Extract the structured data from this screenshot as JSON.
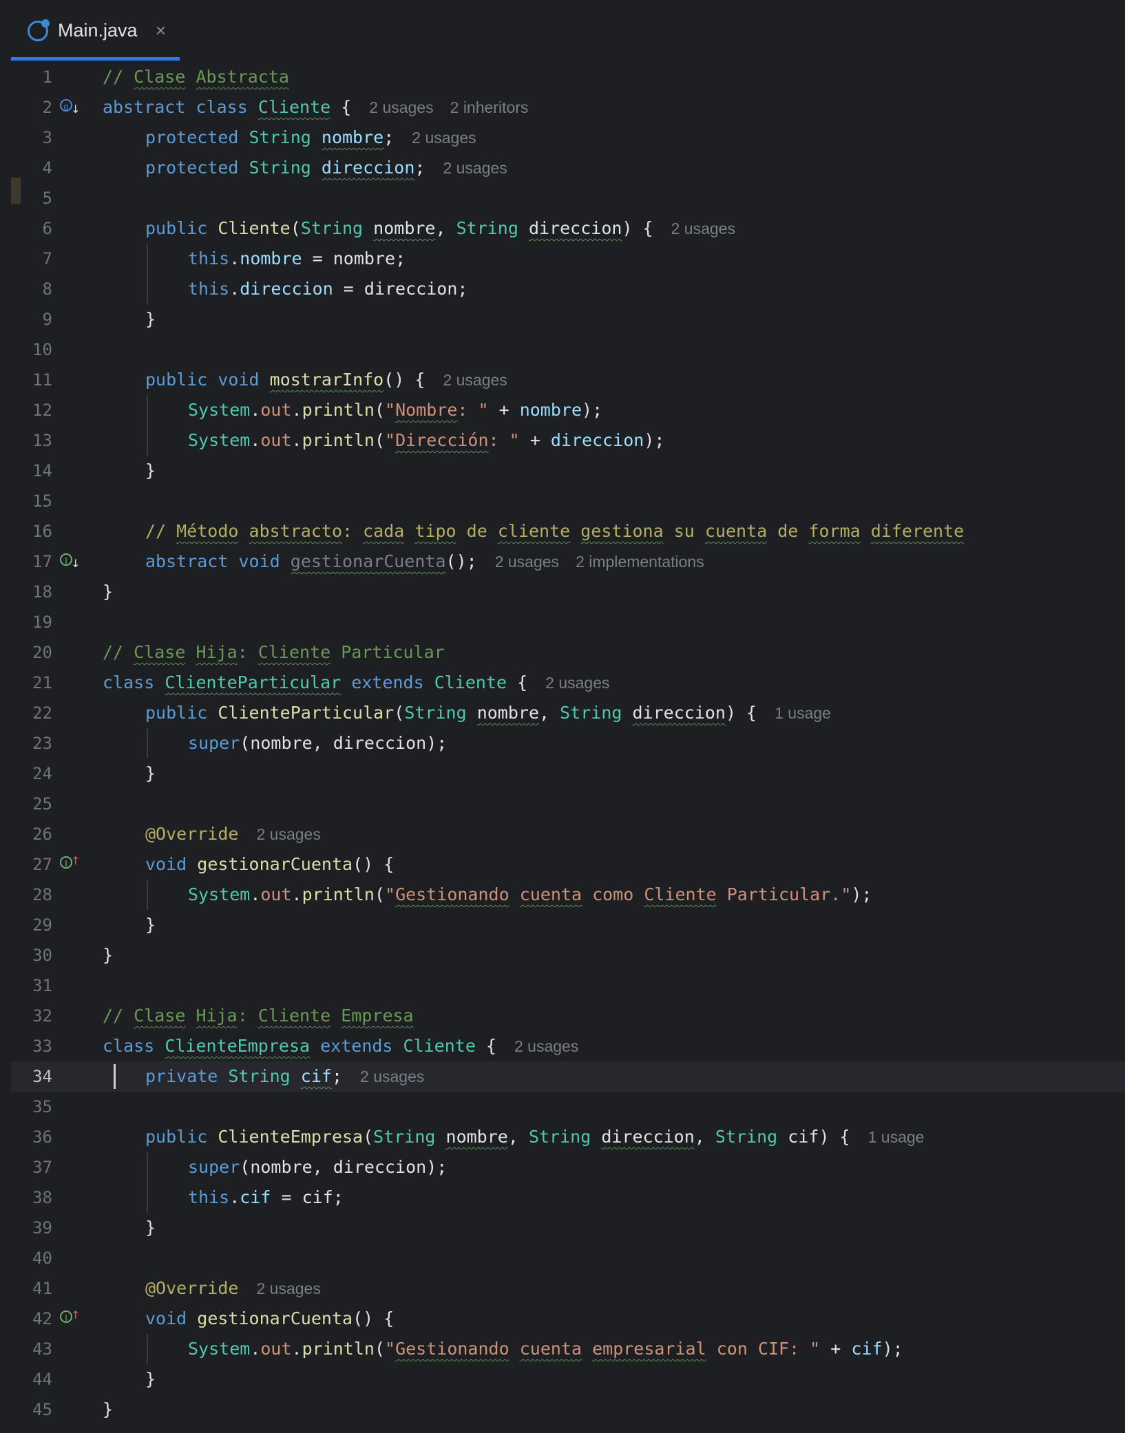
{
  "tab": {
    "title": "Main.java",
    "close_glyph": "×",
    "icon": "java-class-icon"
  },
  "lines": [
    {
      "n": "1",
      "indent": 0,
      "tokens": [
        {
          "c": "c",
          "t": "// "
        },
        {
          "c": "c u",
          "t": "Clase"
        },
        {
          "c": "c",
          "t": " "
        },
        {
          "c": "c u",
          "t": "Abstracta"
        }
      ],
      "hints": []
    },
    {
      "n": "2",
      "indent": 0,
      "icon": "abstract-implemented",
      "tokens": [
        {
          "c": "k",
          "t": "abstract"
        },
        {
          "c": "o",
          "t": " "
        },
        {
          "c": "k",
          "t": "class"
        },
        {
          "c": "o",
          "t": " "
        },
        {
          "c": "t u",
          "t": "Cliente"
        },
        {
          "c": "o",
          "t": " {"
        }
      ],
      "hints": [
        "2 usages",
        "2 inheritors"
      ]
    },
    {
      "n": "3",
      "indent": 1,
      "tokens": [
        {
          "c": "k",
          "t": "protected"
        },
        {
          "c": "o",
          "t": " "
        },
        {
          "c": "t",
          "t": "String"
        },
        {
          "c": "o",
          "t": " "
        },
        {
          "c": "v u",
          "t": "nombre"
        },
        {
          "c": "o",
          "t": ";"
        }
      ],
      "hints": [
        "2 usages"
      ]
    },
    {
      "n": "4",
      "indent": 1,
      "tokens": [
        {
          "c": "k",
          "t": "protected"
        },
        {
          "c": "o",
          "t": " "
        },
        {
          "c": "t",
          "t": "String"
        },
        {
          "c": "o",
          "t": " "
        },
        {
          "c": "v u",
          "t": "direccion"
        },
        {
          "c": "o",
          "t": ";"
        }
      ],
      "hints": [
        "2 usages"
      ]
    },
    {
      "n": "5",
      "indent": 0,
      "tokens": [],
      "hints": []
    },
    {
      "n": "6",
      "indent": 1,
      "tokens": [
        {
          "c": "k",
          "t": "public"
        },
        {
          "c": "o",
          "t": " "
        },
        {
          "c": "f",
          "t": "Cliente"
        },
        {
          "c": "o",
          "t": "("
        },
        {
          "c": "t",
          "t": "String"
        },
        {
          "c": "o",
          "t": " "
        },
        {
          "c": "p u",
          "t": "nombre"
        },
        {
          "c": "o",
          "t": ", "
        },
        {
          "c": "t",
          "t": "String"
        },
        {
          "c": "o",
          "t": " "
        },
        {
          "c": "p u",
          "t": "direccion"
        },
        {
          "c": "o",
          "t": ") {"
        }
      ],
      "hints": [
        "2 usages"
      ]
    },
    {
      "n": "7",
      "indent": 2,
      "tokens": [
        {
          "c": "k",
          "t": "this"
        },
        {
          "c": "o",
          "t": "."
        },
        {
          "c": "v",
          "t": "nombre"
        },
        {
          "c": "o",
          "t": " = "
        },
        {
          "c": "p",
          "t": "nombre"
        },
        {
          "c": "o",
          "t": ";"
        }
      ],
      "hints": []
    },
    {
      "n": "8",
      "indent": 2,
      "tokens": [
        {
          "c": "k",
          "t": "this"
        },
        {
          "c": "o",
          "t": "."
        },
        {
          "c": "v",
          "t": "direccion"
        },
        {
          "c": "o",
          "t": " = "
        },
        {
          "c": "p",
          "t": "direccion"
        },
        {
          "c": "o",
          "t": ";"
        }
      ],
      "hints": []
    },
    {
      "n": "9",
      "indent": 1,
      "tokens": [
        {
          "c": "o",
          "t": "}"
        }
      ],
      "hints": []
    },
    {
      "n": "10",
      "indent": 0,
      "tokens": [],
      "hints": []
    },
    {
      "n": "11",
      "indent": 1,
      "tokens": [
        {
          "c": "k",
          "t": "public"
        },
        {
          "c": "o",
          "t": " "
        },
        {
          "c": "k",
          "t": "void"
        },
        {
          "c": "o",
          "t": " "
        },
        {
          "c": "f u",
          "t": "mostrarInfo"
        },
        {
          "c": "o",
          "t": "() {"
        }
      ],
      "hints": [
        "2 usages"
      ]
    },
    {
      "n": "12",
      "indent": 2,
      "tokens": [
        {
          "c": "t",
          "t": "System"
        },
        {
          "c": "o",
          "t": "."
        },
        {
          "c": "s",
          "t": "out"
        },
        {
          "c": "o",
          "t": "."
        },
        {
          "c": "f",
          "t": "println"
        },
        {
          "c": "o",
          "t": "("
        },
        {
          "c": "s",
          "t": "\""
        },
        {
          "c": "s u",
          "t": "Nombre"
        },
        {
          "c": "s",
          "t": ": \""
        },
        {
          "c": "o",
          "t": " + "
        },
        {
          "c": "v",
          "t": "nombre"
        },
        {
          "c": "o",
          "t": ");"
        }
      ],
      "hints": []
    },
    {
      "n": "13",
      "indent": 2,
      "tokens": [
        {
          "c": "t",
          "t": "System"
        },
        {
          "c": "o",
          "t": "."
        },
        {
          "c": "s",
          "t": "out"
        },
        {
          "c": "o",
          "t": "."
        },
        {
          "c": "f",
          "t": "println"
        },
        {
          "c": "o",
          "t": "("
        },
        {
          "c": "s",
          "t": "\""
        },
        {
          "c": "s u",
          "t": "Dirección"
        },
        {
          "c": "s",
          "t": ": \""
        },
        {
          "c": "o",
          "t": " + "
        },
        {
          "c": "v",
          "t": "direccion"
        },
        {
          "c": "o",
          "t": ");"
        }
      ],
      "hints": []
    },
    {
      "n": "14",
      "indent": 1,
      "tokens": [
        {
          "c": "o",
          "t": "}"
        }
      ],
      "hints": []
    },
    {
      "n": "15",
      "indent": 0,
      "tokens": [],
      "hints": []
    },
    {
      "n": "16",
      "indent": 1,
      "tokens": [
        {
          "c": "a",
          "t": "// "
        },
        {
          "c": "a u",
          "t": "Método"
        },
        {
          "c": "a",
          "t": " "
        },
        {
          "c": "a u",
          "t": "abstracto"
        },
        {
          "c": "a",
          "t": ": "
        },
        {
          "c": "a u",
          "t": "cada"
        },
        {
          "c": "a",
          "t": " "
        },
        {
          "c": "a u",
          "t": "tipo"
        },
        {
          "c": "a",
          "t": " de "
        },
        {
          "c": "a u",
          "t": "cliente"
        },
        {
          "c": "a",
          "t": " "
        },
        {
          "c": "a u",
          "t": "gestiona"
        },
        {
          "c": "a",
          "t": " su "
        },
        {
          "c": "a u",
          "t": "cuenta"
        },
        {
          "c": "a",
          "t": " de "
        },
        {
          "c": "a u",
          "t": "forma"
        },
        {
          "c": "a",
          "t": " "
        },
        {
          "c": "a u",
          "t": "diferente"
        }
      ],
      "hints": []
    },
    {
      "n": "17",
      "indent": 1,
      "icon": "interface-implemented",
      "tokens": [
        {
          "c": "k",
          "t": "abstract"
        },
        {
          "c": "o",
          "t": " "
        },
        {
          "c": "k",
          "t": "void"
        },
        {
          "c": "o",
          "t": " "
        },
        {
          "c": "d u",
          "t": "gestionarCuenta"
        },
        {
          "c": "o",
          "t": "();"
        }
      ],
      "hints": [
        "2 usages",
        "2 implementations"
      ]
    },
    {
      "n": "18",
      "indent": 0,
      "tokens": [
        {
          "c": "o",
          "t": "}"
        }
      ],
      "hints": []
    },
    {
      "n": "19",
      "indent": 0,
      "tokens": [],
      "hints": []
    },
    {
      "n": "20",
      "indent": 0,
      "tokens": [
        {
          "c": "c",
          "t": "// "
        },
        {
          "c": "c u",
          "t": "Clase"
        },
        {
          "c": "c",
          "t": " "
        },
        {
          "c": "c u",
          "t": "Hija"
        },
        {
          "c": "c",
          "t": ": "
        },
        {
          "c": "c u",
          "t": "Cliente"
        },
        {
          "c": "c",
          "t": " Particular"
        }
      ],
      "hints": []
    },
    {
      "n": "21",
      "indent": 0,
      "tokens": [
        {
          "c": "k",
          "t": "class"
        },
        {
          "c": "o",
          "t": " "
        },
        {
          "c": "t u",
          "t": "ClienteParticular"
        },
        {
          "c": "o",
          "t": " "
        },
        {
          "c": "k",
          "t": "extends"
        },
        {
          "c": "o",
          "t": " "
        },
        {
          "c": "t",
          "t": "Cliente"
        },
        {
          "c": "o",
          "t": " {"
        }
      ],
      "hints": [
        "2 usages"
      ]
    },
    {
      "n": "22",
      "indent": 1,
      "tokens": [
        {
          "c": "k",
          "t": "public"
        },
        {
          "c": "o",
          "t": " "
        },
        {
          "c": "f",
          "t": "ClienteParticular"
        },
        {
          "c": "o",
          "t": "("
        },
        {
          "c": "t",
          "t": "String"
        },
        {
          "c": "o",
          "t": " "
        },
        {
          "c": "p u",
          "t": "nombre"
        },
        {
          "c": "o",
          "t": ", "
        },
        {
          "c": "t",
          "t": "String"
        },
        {
          "c": "o",
          "t": " "
        },
        {
          "c": "p u",
          "t": "direccion"
        },
        {
          "c": "o",
          "t": ") {"
        }
      ],
      "hints": [
        "1 usage"
      ]
    },
    {
      "n": "23",
      "indent": 2,
      "tokens": [
        {
          "c": "k",
          "t": "super"
        },
        {
          "c": "o",
          "t": "("
        },
        {
          "c": "p",
          "t": "nombre"
        },
        {
          "c": "o",
          "t": ", "
        },
        {
          "c": "p",
          "t": "direccion"
        },
        {
          "c": "o",
          "t": ");"
        }
      ],
      "hints": []
    },
    {
      "n": "24",
      "indent": 1,
      "tokens": [
        {
          "c": "o",
          "t": "}"
        }
      ],
      "hints": []
    },
    {
      "n": "25",
      "indent": 0,
      "tokens": [],
      "hints": []
    },
    {
      "n": "26",
      "indent": 1,
      "tokens": [
        {
          "c": "a",
          "t": "@Override"
        }
      ],
      "hints": [
        "2 usages"
      ]
    },
    {
      "n": "27",
      "indent": 1,
      "icon": "implements-method",
      "tokens": [
        {
          "c": "k",
          "t": "void"
        },
        {
          "c": "o",
          "t": " "
        },
        {
          "c": "f",
          "t": "gestionarCuenta"
        },
        {
          "c": "o",
          "t": "() {"
        }
      ],
      "hints": []
    },
    {
      "n": "28",
      "indent": 2,
      "tokens": [
        {
          "c": "t",
          "t": "System"
        },
        {
          "c": "o",
          "t": "."
        },
        {
          "c": "s",
          "t": "out"
        },
        {
          "c": "o",
          "t": "."
        },
        {
          "c": "f",
          "t": "println"
        },
        {
          "c": "o",
          "t": "("
        },
        {
          "c": "s",
          "t": "\""
        },
        {
          "c": "s u",
          "t": "Gestionando"
        },
        {
          "c": "s",
          "t": " "
        },
        {
          "c": "s u",
          "t": "cuenta"
        },
        {
          "c": "s",
          "t": " como "
        },
        {
          "c": "s u",
          "t": "Cliente"
        },
        {
          "c": "s",
          "t": " Particular.\""
        },
        {
          "c": "o",
          "t": ");"
        }
      ],
      "hints": []
    },
    {
      "n": "29",
      "indent": 1,
      "tokens": [
        {
          "c": "o",
          "t": "}"
        }
      ],
      "hints": []
    },
    {
      "n": "30",
      "indent": 0,
      "tokens": [
        {
          "c": "o",
          "t": "}"
        }
      ],
      "hints": []
    },
    {
      "n": "31",
      "indent": 0,
      "tokens": [],
      "hints": []
    },
    {
      "n": "32",
      "indent": 0,
      "tokens": [
        {
          "c": "c",
          "t": "// "
        },
        {
          "c": "c u",
          "t": "Clase"
        },
        {
          "c": "c",
          "t": " "
        },
        {
          "c": "c u",
          "t": "Hija"
        },
        {
          "c": "c",
          "t": ": "
        },
        {
          "c": "c u",
          "t": "Cliente"
        },
        {
          "c": "c",
          "t": " "
        },
        {
          "c": "c u",
          "t": "Empresa"
        }
      ],
      "hints": []
    },
    {
      "n": "33",
      "indent": 0,
      "tokens": [
        {
          "c": "k",
          "t": "class"
        },
        {
          "c": "o",
          "t": " "
        },
        {
          "c": "t u",
          "t": "ClienteEmpresa"
        },
        {
          "c": "o",
          "t": " "
        },
        {
          "c": "k",
          "t": "extends"
        },
        {
          "c": "o",
          "t": " "
        },
        {
          "c": "t",
          "t": "Cliente"
        },
        {
          "c": "o",
          "t": " {"
        }
      ],
      "hints": [
        "2 usages"
      ]
    },
    {
      "n": "34",
      "indent": 1,
      "current": true,
      "tokens": [
        {
          "c": "k",
          "t": "private"
        },
        {
          "c": "o",
          "t": " "
        },
        {
          "c": "t",
          "t": "String"
        },
        {
          "c": "o",
          "t": " "
        },
        {
          "c": "v u",
          "t": "cif"
        },
        {
          "c": "o",
          "t": ";"
        }
      ],
      "hints": [
        "2 usages"
      ]
    },
    {
      "n": "35",
      "indent": 0,
      "tokens": [],
      "hints": []
    },
    {
      "n": "36",
      "indent": 1,
      "tokens": [
        {
          "c": "k",
          "t": "public"
        },
        {
          "c": "o",
          "t": " "
        },
        {
          "c": "f",
          "t": "ClienteEmpresa"
        },
        {
          "c": "o",
          "t": "("
        },
        {
          "c": "t",
          "t": "String"
        },
        {
          "c": "o",
          "t": " "
        },
        {
          "c": "p u",
          "t": "nombre"
        },
        {
          "c": "o",
          "t": ", "
        },
        {
          "c": "t",
          "t": "String"
        },
        {
          "c": "o",
          "t": " "
        },
        {
          "c": "p u",
          "t": "direccion"
        },
        {
          "c": "o",
          "t": ", "
        },
        {
          "c": "t",
          "t": "String"
        },
        {
          "c": "o",
          "t": " "
        },
        {
          "c": "p",
          "t": "cif"
        },
        {
          "c": "o",
          "t": ") {"
        }
      ],
      "hints": [
        "1 usage"
      ]
    },
    {
      "n": "37",
      "indent": 2,
      "tokens": [
        {
          "c": "k",
          "t": "super"
        },
        {
          "c": "o",
          "t": "("
        },
        {
          "c": "p",
          "t": "nombre"
        },
        {
          "c": "o",
          "t": ", "
        },
        {
          "c": "p",
          "t": "direccion"
        },
        {
          "c": "o",
          "t": ");"
        }
      ],
      "hints": []
    },
    {
      "n": "38",
      "indent": 2,
      "tokens": [
        {
          "c": "k",
          "t": "this"
        },
        {
          "c": "o",
          "t": "."
        },
        {
          "c": "v",
          "t": "cif"
        },
        {
          "c": "o",
          "t": " = "
        },
        {
          "c": "p",
          "t": "cif"
        },
        {
          "c": "o",
          "t": ";"
        }
      ],
      "hints": []
    },
    {
      "n": "39",
      "indent": 1,
      "tokens": [
        {
          "c": "o",
          "t": "}"
        }
      ],
      "hints": []
    },
    {
      "n": "40",
      "indent": 0,
      "tokens": [],
      "hints": []
    },
    {
      "n": "41",
      "indent": 1,
      "tokens": [
        {
          "c": "a",
          "t": "@Override"
        }
      ],
      "hints": [
        "2 usages"
      ]
    },
    {
      "n": "42",
      "indent": 1,
      "icon": "implements-method",
      "tokens": [
        {
          "c": "k",
          "t": "void"
        },
        {
          "c": "o",
          "t": " "
        },
        {
          "c": "f",
          "t": "gestionarCuenta"
        },
        {
          "c": "o",
          "t": "() {"
        }
      ],
      "hints": []
    },
    {
      "n": "43",
      "indent": 2,
      "tokens": [
        {
          "c": "t",
          "t": "System"
        },
        {
          "c": "o",
          "t": "."
        },
        {
          "c": "s",
          "t": "out"
        },
        {
          "c": "o",
          "t": "."
        },
        {
          "c": "f",
          "t": "println"
        },
        {
          "c": "o",
          "t": "("
        },
        {
          "c": "s",
          "t": "\""
        },
        {
          "c": "s u",
          "t": "Gestionando"
        },
        {
          "c": "s",
          "t": " "
        },
        {
          "c": "s u",
          "t": "cuenta"
        },
        {
          "c": "s",
          "t": " "
        },
        {
          "c": "s u",
          "t": "empresarial"
        },
        {
          "c": "s",
          "t": " con CIF: \""
        },
        {
          "c": "o",
          "t": " + "
        },
        {
          "c": "v",
          "t": "cif"
        },
        {
          "c": "o",
          "t": ");"
        }
      ],
      "hints": []
    },
    {
      "n": "44",
      "indent": 1,
      "tokens": [
        {
          "c": "o",
          "t": "}"
        }
      ],
      "hints": []
    },
    {
      "n": "45",
      "indent": 0,
      "tokens": [
        {
          "c": "o",
          "t": "}"
        }
      ],
      "hints": []
    }
  ]
}
